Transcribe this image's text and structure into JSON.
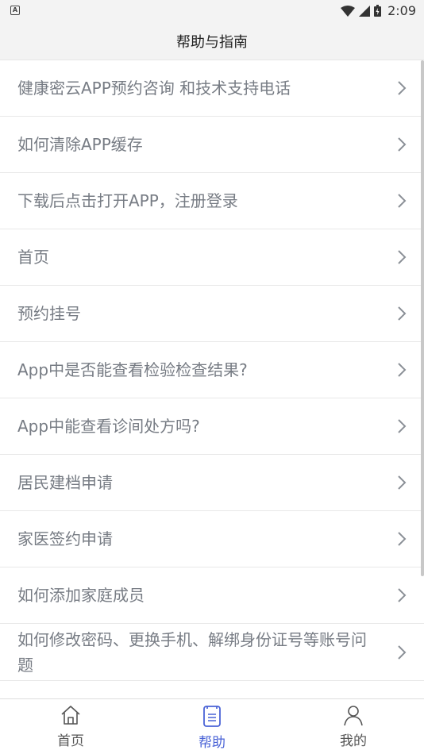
{
  "status_bar": {
    "time": "2:09",
    "indicator": "A"
  },
  "header": {
    "title": "帮助与指南"
  },
  "list": {
    "items": [
      {
        "label": "健康密云APP预约咨询 和技术支持电话"
      },
      {
        "label": "如何清除APP缓存"
      },
      {
        "label": "下载后点击打开APP，注册登录"
      },
      {
        "label": "首页"
      },
      {
        "label": "预约挂号"
      },
      {
        "label": "App中是否能查看检验检查结果?"
      },
      {
        "label": "App中能查看诊间处方吗?"
      },
      {
        "label": "居民建档申请"
      },
      {
        "label": "家医签约申请"
      },
      {
        "label": "如何添加家庭成员"
      },
      {
        "label": "如何修改密码、更换手机、解绑身份证号等账号问题"
      }
    ]
  },
  "tabbar": {
    "tabs": [
      {
        "label": "首页",
        "icon": "home-icon"
      },
      {
        "label": "帮助",
        "icon": "document-icon"
      },
      {
        "label": "我的",
        "icon": "user-icon"
      }
    ],
    "active_color": "#4a63d6",
    "inactive_color": "#555555"
  }
}
